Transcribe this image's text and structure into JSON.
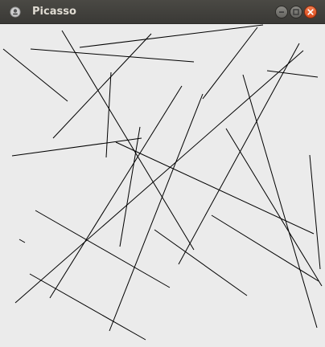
{
  "window": {
    "title": "Picasso",
    "icons": {
      "app": "app-icon",
      "minimize": "minimize-icon",
      "maximize": "maximize-icon",
      "close": "close-icon"
    },
    "colors": {
      "titlebar": "#3c3b37",
      "title_text": "#dfdbd2",
      "close_button": "#e95420",
      "canvas_background": "#ebebeb",
      "line_color": "#000000"
    }
  },
  "drawing": {
    "description_count": 30
  }
}
